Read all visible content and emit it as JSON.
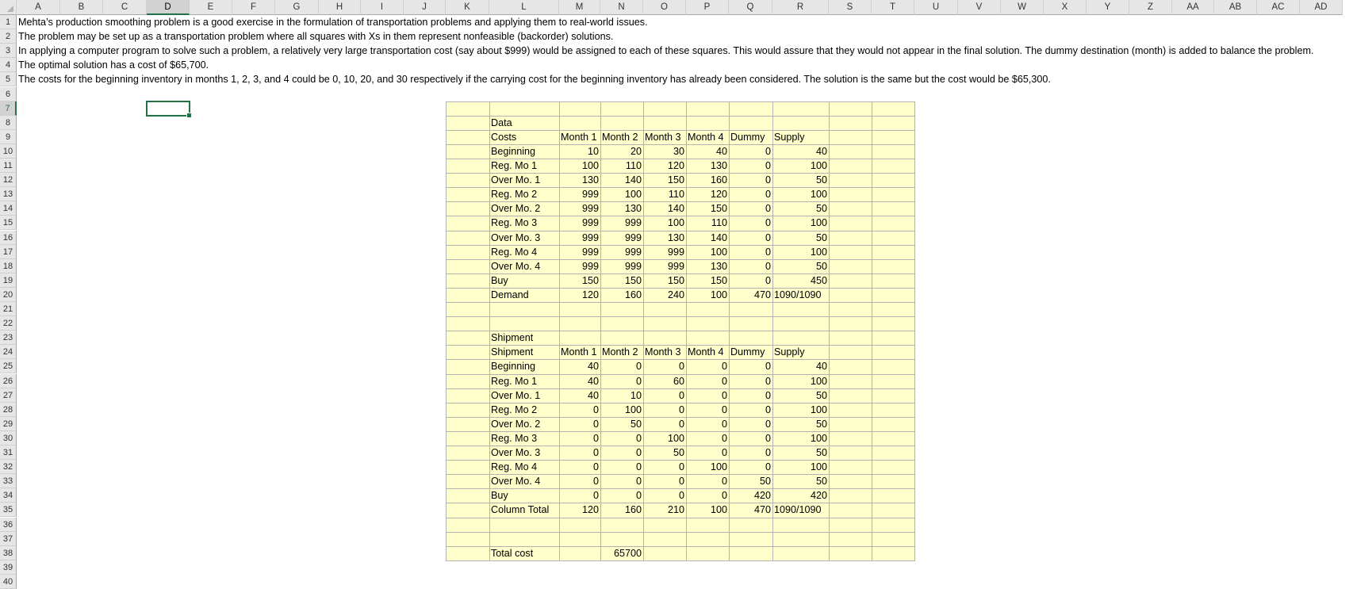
{
  "columns": [
    "A",
    "B",
    "C",
    "D",
    "E",
    "F",
    "G",
    "H",
    "I",
    "J",
    "K",
    "L",
    "M",
    "N",
    "O",
    "P",
    "Q",
    "R",
    "S",
    "T",
    "U",
    "V",
    "W",
    "X",
    "Y",
    "Z",
    "AA",
    "AB",
    "AC",
    "AD"
  ],
  "row_numbers": [
    "1",
    "2",
    "3",
    "4",
    "5",
    "6",
    "7",
    "8",
    "9",
    "10",
    "11",
    "12",
    "13",
    "14",
    "15",
    "16",
    "17",
    "18",
    "19",
    "20",
    "21",
    "22",
    "23",
    "24",
    "25",
    "26",
    "27",
    "28",
    "29",
    "30",
    "31",
    "32",
    "33",
    "34",
    "35",
    "36",
    "37",
    "38",
    "39",
    "40"
  ],
  "selected_cell": "D7",
  "notes": [
    "Mehta’s production smoothing problem is a good exercise in the formulation of transportation problems and applying them to real-world issues.",
    "The problem may be set up as a transportation problem where all squares with Xs in them represent nonfeasible (backorder) solutions.",
    "In applying a computer program to solve such a problem, a relatively very large transportation cost (say about $999) would be assigned to each of these squares. This would assure that they would not appear in the final solution. The dummy destination (month) is added to balance the problem.",
    "The optimal solution has a cost of $65,700.",
    "The costs for the beginning inventory in months 1, 2, 3, and 4 could be 0, 10, 20, and 30 respectively if the carrying cost for the beginning inventory has already been considered. The solution is the same but the cost would be $65,300."
  ],
  "costs_table": {
    "title": "Data",
    "corner": "Costs",
    "headers": [
      "Month 1",
      "Month 2",
      "Month 3",
      "Month 4",
      "Dummy",
      "Supply"
    ],
    "rows": [
      {
        "label": "Beginning",
        "values": [
          "10",
          "20",
          "30",
          "40",
          "0",
          "40"
        ]
      },
      {
        "label": "Reg. Mo 1",
        "values": [
          "100",
          "110",
          "120",
          "130",
          "0",
          "100"
        ]
      },
      {
        "label": "Over Mo. 1",
        "values": [
          "130",
          "140",
          "150",
          "160",
          "0",
          "50"
        ]
      },
      {
        "label": "Reg. Mo 2",
        "values": [
          "999",
          "100",
          "110",
          "120",
          "0",
          "100"
        ]
      },
      {
        "label": "Over Mo. 2",
        "values": [
          "999",
          "130",
          "140",
          "150",
          "0",
          "50"
        ]
      },
      {
        "label": "Reg. Mo 3",
        "values": [
          "999",
          "999",
          "100",
          "110",
          "0",
          "100"
        ]
      },
      {
        "label": "Over Mo. 3",
        "values": [
          "999",
          "999",
          "130",
          "140",
          "0",
          "50"
        ]
      },
      {
        "label": "Reg. Mo 4",
        "values": [
          "999",
          "999",
          "999",
          "100",
          "0",
          "100"
        ]
      },
      {
        "label": "Over Mo. 4",
        "values": [
          "999",
          "999",
          "999",
          "130",
          "0",
          "50"
        ]
      },
      {
        "label": "Buy",
        "values": [
          "150",
          "150",
          "150",
          "150",
          "0",
          "450"
        ]
      }
    ],
    "total": {
      "label": "Demand",
      "values": [
        "120",
        "160",
        "240",
        "100",
        "470",
        "1090/1090"
      ]
    }
  },
  "shipment_table": {
    "title": "Shipment",
    "corner": "Shipment",
    "headers": [
      "Month 1",
      "Month 2",
      "Month 3",
      "Month 4",
      "Dummy",
      "Supply"
    ],
    "rows": [
      {
        "label": "Beginning",
        "values": [
          "40",
          "0",
          "0",
          "0",
          "0",
          "40"
        ]
      },
      {
        "label": "Reg. Mo 1",
        "values": [
          "40",
          "0",
          "60",
          "0",
          "0",
          "100"
        ]
      },
      {
        "label": "Over Mo. 1",
        "values": [
          "40",
          "10",
          "0",
          "0",
          "0",
          "50"
        ]
      },
      {
        "label": "Reg. Mo 2",
        "values": [
          "0",
          "100",
          "0",
          "0",
          "0",
          "100"
        ]
      },
      {
        "label": "Over Mo. 2",
        "values": [
          "0",
          "50",
          "0",
          "0",
          "0",
          "50"
        ]
      },
      {
        "label": "Reg. Mo 3",
        "values": [
          "0",
          "0",
          "100",
          "0",
          "0",
          "100"
        ]
      },
      {
        "label": "Over Mo. 3",
        "values": [
          "0",
          "0",
          "50",
          "0",
          "0",
          "50"
        ]
      },
      {
        "label": "Reg. Mo 4",
        "values": [
          "0",
          "0",
          "0",
          "100",
          "0",
          "100"
        ]
      },
      {
        "label": "Over Mo. 4",
        "values": [
          "0",
          "0",
          "0",
          "0",
          "50",
          "50"
        ]
      },
      {
        "label": "Buy",
        "values": [
          "0",
          "0",
          "0",
          "0",
          "420",
          "420"
        ]
      }
    ],
    "total": {
      "label": "Column Total",
      "values": [
        "120",
        "160",
        "210",
        "100",
        "470",
        "1090/1090"
      ]
    }
  },
  "total_cost": {
    "label": "Total cost",
    "value": "65700"
  },
  "colors": {
    "fill": "#ffffcc",
    "grid": "#b2b2b2",
    "accent": "#217346"
  }
}
